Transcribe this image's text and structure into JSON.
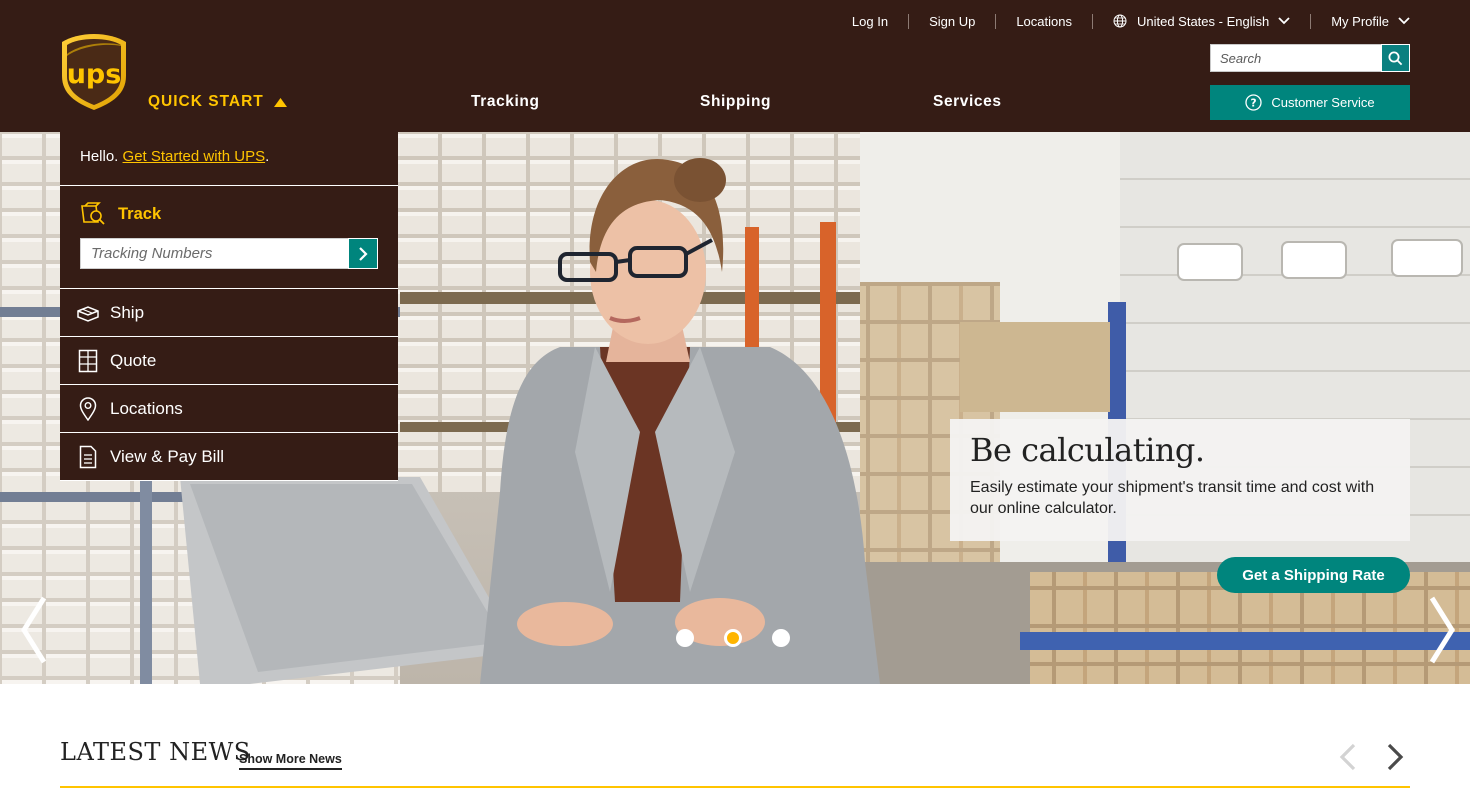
{
  "header": {
    "utility": {
      "log_in": "Log In",
      "sign_up": "Sign Up",
      "locations": "Locations",
      "language": "United States - English",
      "profile": "My Profile"
    },
    "search": {
      "placeholder": "Search"
    },
    "customer_service": "Customer Service",
    "quick_start": "QUICK START",
    "nav": {
      "tracking": "Tracking",
      "shipping": "Shipping",
      "services": "Services"
    },
    "logo_text": "ups"
  },
  "quick_start_panel": {
    "hello": "Hello.",
    "get_started": "Get Started with UPS",
    "period": ".",
    "track": {
      "label": "Track",
      "placeholder": "Tracking Numbers"
    },
    "items": [
      {
        "label": "Ship",
        "icon": "ship-box-icon"
      },
      {
        "label": "Quote",
        "icon": "calculator-icon"
      },
      {
        "label": "Locations",
        "icon": "location-pin-icon"
      },
      {
        "label": "View & Pay Bill",
        "icon": "document-icon"
      }
    ]
  },
  "hero": {
    "headline": "Be calculating.",
    "body": "Easily estimate your shipment's transit time and cost with our online calculator.",
    "cta": "Get a Shipping Rate",
    "slides_total": 3,
    "active_slide": 2
  },
  "news": {
    "title": "LATEST NEWS",
    "more": "Show More News"
  },
  "colors": {
    "brown": "#351c15",
    "gold": "#ffc400",
    "teal": "#00857d"
  }
}
